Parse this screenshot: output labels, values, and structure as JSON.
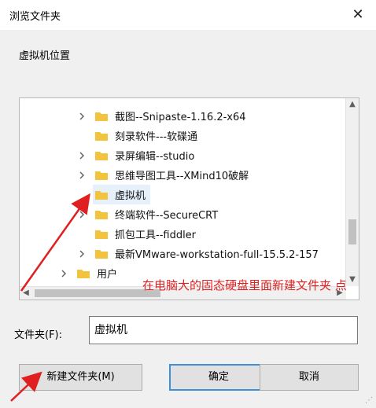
{
  "window": {
    "title": "浏览文件夹"
  },
  "prompt": "虚拟机位置",
  "tree": {
    "items": [
      {
        "label": "截图--Snipaste-1.16.2-x64",
        "expandable": true
      },
      {
        "label": "刻录软件---软碟通",
        "expandable": false
      },
      {
        "label": "录屏编辑--studio",
        "expandable": true
      },
      {
        "label": "思维导图工具--XMind10破解",
        "expandable": true
      },
      {
        "label": "虚拟机",
        "expandable": false,
        "selected": true
      },
      {
        "label": "终端软件--SecureCRT",
        "expandable": true
      },
      {
        "label": "抓包工具--fiddler",
        "expandable": false
      },
      {
        "label": "最新VMware-workstation-full-15.5.2-157",
        "expandable": true
      },
      {
        "label": "用户",
        "expandable": true
      }
    ]
  },
  "annotation": "在电脑大的固态硬盘里面新建文件夹 点",
  "folder_field": {
    "label": "文件夹(F):",
    "value": "虚拟机"
  },
  "buttons": {
    "new_folder": "新建文件夹(M)",
    "ok": "确定",
    "cancel": "取消"
  },
  "colors": {
    "folder": "#f2c33d",
    "annotation": "#e02020",
    "selected": "#e6f0fb",
    "ok_border": "#3f8fd8"
  }
}
